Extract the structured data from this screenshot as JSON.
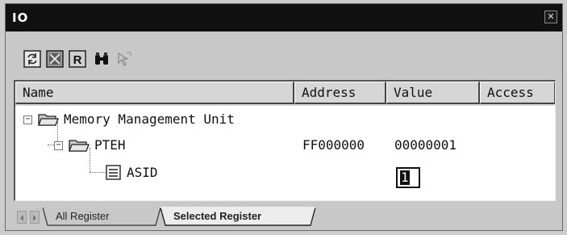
{
  "window": {
    "title": "IO",
    "close_glyph": "✕"
  },
  "toolbar": {
    "buttons": [
      {
        "icon": "refresh-icon"
      },
      {
        "icon": "clear-icon"
      },
      {
        "icon": "register-icon",
        "glyph": "R"
      },
      {
        "icon": "binoculars-icon"
      },
      {
        "icon": "locate-icon"
      }
    ]
  },
  "columns": {
    "name": "Name",
    "address": "Address",
    "value": "Value",
    "access": "Access"
  },
  "tree": {
    "root": {
      "label": "Memory Management Unit",
      "expander": "−"
    },
    "group": {
      "label": "PTEH",
      "expander": "−",
      "address": "FF000000",
      "value": "00000001"
    },
    "field": {
      "label": "ASID",
      "value": "1"
    }
  },
  "tabs": {
    "all": "All Register",
    "selected": "Selected Register"
  }
}
